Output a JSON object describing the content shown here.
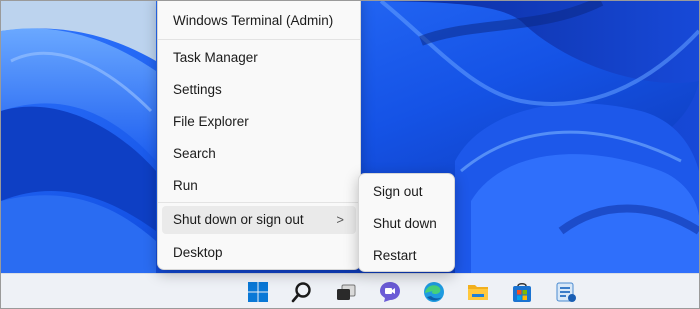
{
  "context_menu": {
    "items": [
      {
        "label": "Windows Terminal (Admin)"
      },
      {
        "label": "Task Manager"
      },
      {
        "label": "Settings"
      },
      {
        "label": "File Explorer"
      },
      {
        "label": "Search"
      },
      {
        "label": "Run"
      },
      {
        "label": "Shut down or sign out"
      },
      {
        "label": "Desktop"
      }
    ],
    "submenu_chevron": ">"
  },
  "submenu": {
    "items": [
      {
        "label": "Sign out"
      },
      {
        "label": "Shut down"
      },
      {
        "label": "Restart"
      }
    ]
  },
  "taskbar": {
    "icons": [
      "windows-start-icon",
      "search-icon",
      "task-view-icon",
      "teams-chat-icon",
      "edge-icon",
      "file-explorer-icon",
      "microsoft-store-icon",
      "snipping-tool-icon"
    ]
  },
  "colors": {
    "wallpaper_base": "#1a55e0",
    "wallpaper_light": "#3f8cff",
    "wallpaper_dark": "#0b2fa8",
    "menu_bg": "#f9f9f9",
    "taskbar_bg": "#eef1f6",
    "accent": "#0067c0"
  }
}
